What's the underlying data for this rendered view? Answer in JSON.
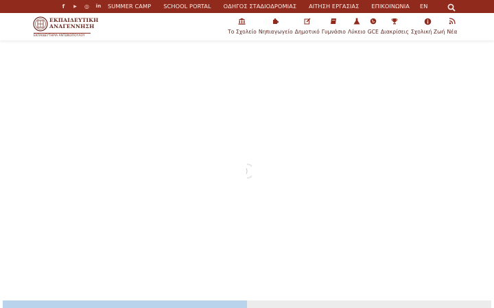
{
  "colors": {
    "topbar": "#8f2a1d",
    "brand": "#6b2a22",
    "strip_left": "#b9d3ec",
    "strip_right": "#ececec"
  },
  "social": [
    {
      "name": "facebook-icon",
      "glyph": "f"
    },
    {
      "name": "youtube-icon",
      "glyph": "▶"
    },
    {
      "name": "instagram-icon",
      "glyph": "◎"
    },
    {
      "name": "linkedin-icon",
      "glyph": "in"
    }
  ],
  "topnav": {
    "summer_camp": "SUMMER CAMP",
    "school_portal": "SCHOOL PORTAL",
    "career_guide": "ΟΔΗΓΟΣ ΣΤΑΔΙΟΔΡΟΜΙΑΣ",
    "job_application": "ΑΙΤΗΣΗ ΕΡΓΑΣΙΑΣ",
    "contact": "ΕΠΙΚΟΙΝΩΝΙΑ",
    "lang": "EN"
  },
  "logo": {
    "line1": "ΕΚΠΑΙΔΕΥΤΙΚΗ",
    "line2": "ΑΝΑΓΕΝΝΗΣΗ",
    "sub": "ΕΚΠΑΙΔΕΥΤΗΡΙΑ ΑΝΤΩΝΟΠΟΥΛΟΥ"
  },
  "mainnav": [
    {
      "label": "Το Σχολείο",
      "icon": "institution-icon"
    },
    {
      "label": "Νηπιαγωγείο",
      "icon": "puzzle-icon"
    },
    {
      "label": "Δημοτικό",
      "icon": "edit-icon"
    },
    {
      "label": "Γυμνάσιο",
      "icon": "book-icon"
    },
    {
      "label": "Λύκειο",
      "icon": "flask-icon"
    },
    {
      "label": "GCE",
      "icon": "globe-icon"
    },
    {
      "label": "Διακρίσεις",
      "icon": "trophy-icon"
    },
    {
      "label": "Σχολική Ζωή",
      "icon": "info-icon"
    },
    {
      "label": "Νέα",
      "icon": "rss-icon"
    }
  ]
}
